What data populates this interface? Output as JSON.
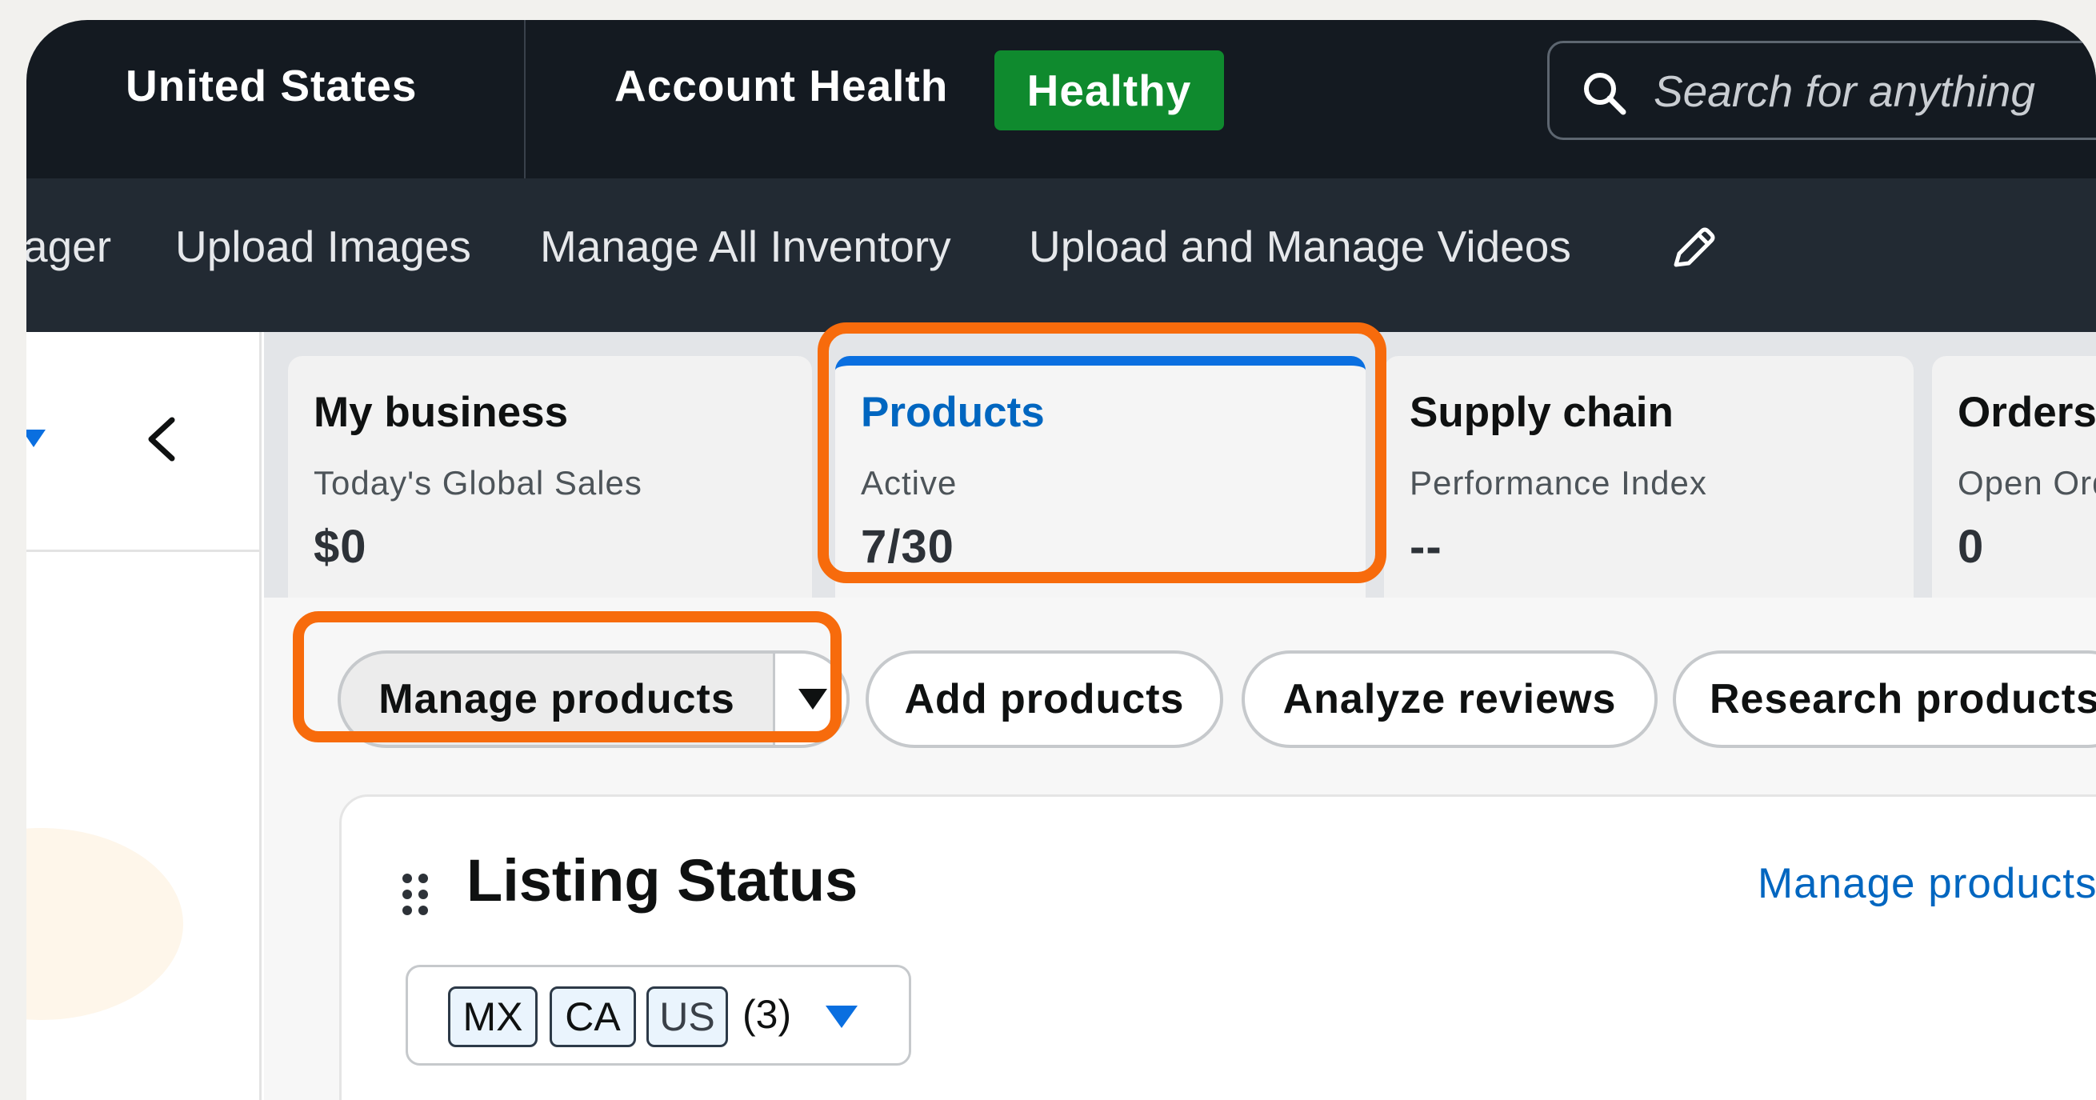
{
  "topbar": {
    "country": "United States",
    "account_health_label": "Account Health",
    "account_health_status": "Healthy",
    "search_placeholder": "Search for anything",
    "colors": {
      "background": "#141a21",
      "healthy_badge": "#0f8a2e"
    }
  },
  "nav": {
    "items": [
      {
        "label": "ager"
      },
      {
        "label": "Upload Images"
      },
      {
        "label": "Manage All Inventory"
      },
      {
        "label": "Upload and Manage Videos"
      }
    ],
    "edit_icon": "pencil-icon"
  },
  "left_panel": {
    "dropdown_icon": "caret-down-icon",
    "collapse_icon": "chevron-left-icon"
  },
  "tabs": [
    {
      "title": "My business",
      "metric": "Today's Global Sales",
      "value": "$0",
      "selected": false
    },
    {
      "title": "Products",
      "metric": "Active",
      "value": "7/30",
      "selected": true
    },
    {
      "title": "Supply chain",
      "metric": "Performance Index",
      "value": "--",
      "selected": false
    },
    {
      "title": "Orders",
      "metric": "Open Orders",
      "value": "0",
      "selected": false
    }
  ],
  "actions": {
    "manage_products": "Manage products",
    "add_products": "Add products",
    "analyze_reviews": "Analyze reviews",
    "research_products": "Research products"
  },
  "listing_status": {
    "title": "Listing Status",
    "link": "Manage products",
    "chips": [
      "MX",
      "CA",
      "US"
    ],
    "count": "(3)"
  },
  "highlight_color": "#f76b0c",
  "accent_color": "#0066c0"
}
